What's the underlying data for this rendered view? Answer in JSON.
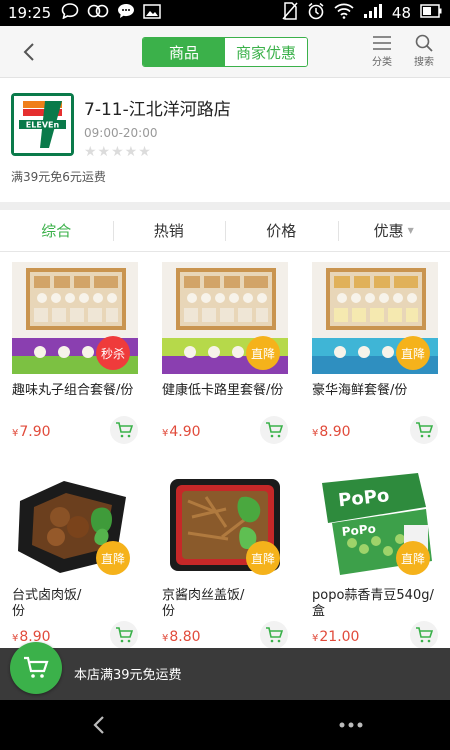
{
  "status": {
    "time": "19:25",
    "battery": "48"
  },
  "header": {
    "tabs": [
      "商品",
      "商家优惠"
    ],
    "category_label": "分类",
    "search_label": "搜索"
  },
  "store": {
    "name": "7-11-江北洋河路店",
    "hours": "09:00-20:00",
    "rating_stars": "★★★★★",
    "shipping_note": "满39元免6元运费",
    "logo_text": "ELEVEn"
  },
  "sort_tabs": [
    "综合",
    "热销",
    "价格",
    "优惠"
  ],
  "products": [
    {
      "name": "趣味丸子组合套餐/份",
      "price": "7.90",
      "badge": "秒杀"
    },
    {
      "name": "健康低卡路里套餐/份",
      "price": "4.90",
      "badge": "直降"
    },
    {
      "name": "豪华海鲜套餐/份",
      "price": "8.90",
      "badge": "直降"
    },
    {
      "name": "台式卤肉饭/\n份",
      "price": "8.90",
      "badge": "直降"
    },
    {
      "name": "京酱肉丝盖饭/\n份",
      "price": "8.80",
      "badge": "直降"
    },
    {
      "name": "popo蒜香青豆540g/盒",
      "price": "21.00",
      "badge": "直降"
    }
  ],
  "currency": "¥",
  "bottom": {
    "promo": "本店满39元免运费"
  },
  "colors": {
    "accent": "#3bb14a",
    "price": "#e14b3b",
    "badge_red": "#ef3b3b",
    "badge_yellow": "#f5b21b"
  }
}
